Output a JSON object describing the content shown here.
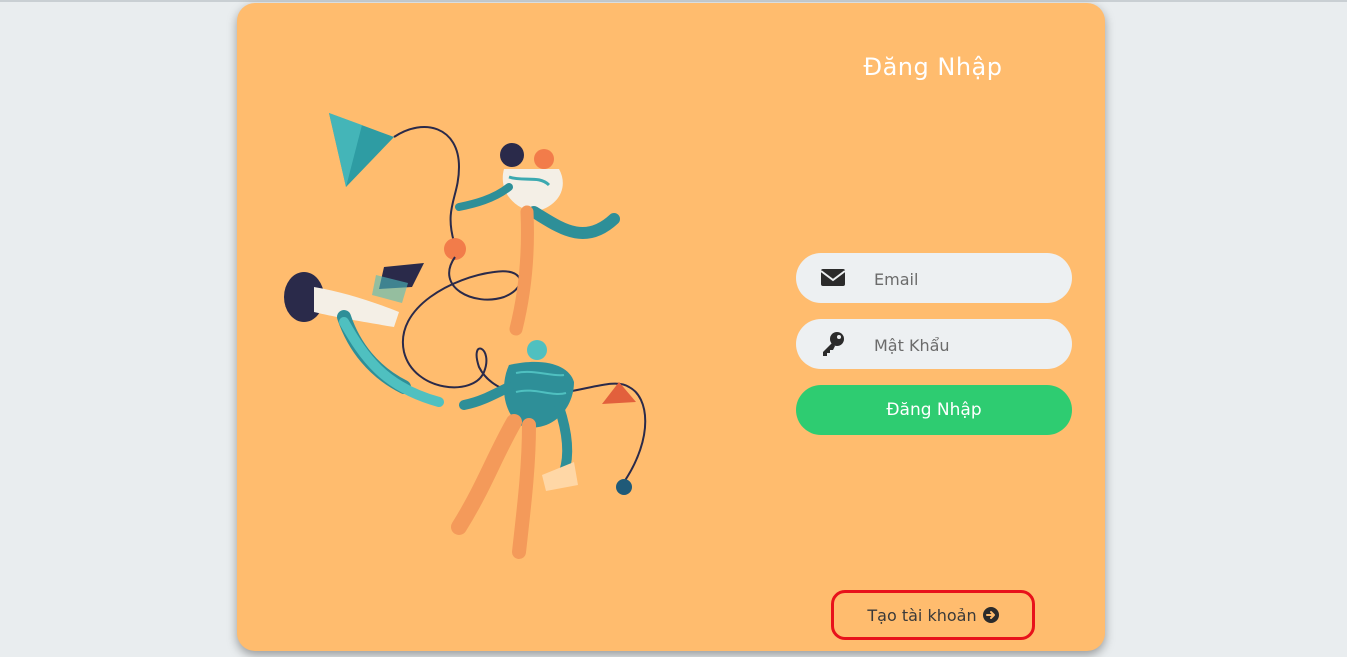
{
  "page": {
    "background": "#e9edef",
    "card_color": "#ffbc6e"
  },
  "login": {
    "title": "Đăng Nhập",
    "email_placeholder": "Email",
    "password_placeholder": "Mật Khẩu",
    "submit_label": "Đăng Nhập",
    "submit_color": "#2ecc71",
    "email_icon": "envelope-icon",
    "password_icon": "key-icon"
  },
  "footer": {
    "create_account_label": "Tạo tài khoản",
    "create_account_icon": "arrow-circle-right-icon",
    "highlight_color": "#e8121b"
  }
}
